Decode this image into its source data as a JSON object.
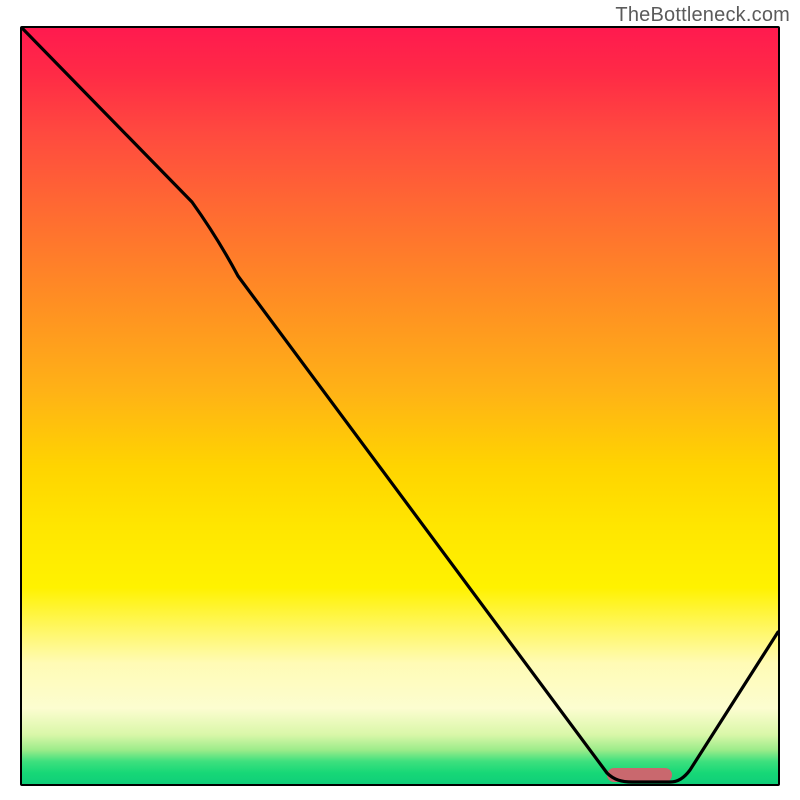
{
  "watermark": "TheBottleneck.com",
  "chart_data": {
    "type": "line",
    "title": "",
    "xlabel": "",
    "ylabel": "",
    "xlim": [
      0,
      100
    ],
    "ylim": [
      0,
      100
    ],
    "series": [
      {
        "name": "bottleneck-curve",
        "x": [
          0,
          22,
          78,
          86,
          100
        ],
        "values": [
          100,
          77,
          0,
          0,
          20
        ]
      }
    ],
    "annotations": [
      {
        "name": "optimal-range",
        "x_start": 78,
        "x_end": 86,
        "y": 0,
        "color": "#c9686e"
      }
    ],
    "background_gradient": {
      "top": "#ff1a4f",
      "mid": "#ffd400",
      "bottom": "#0fce78"
    }
  }
}
